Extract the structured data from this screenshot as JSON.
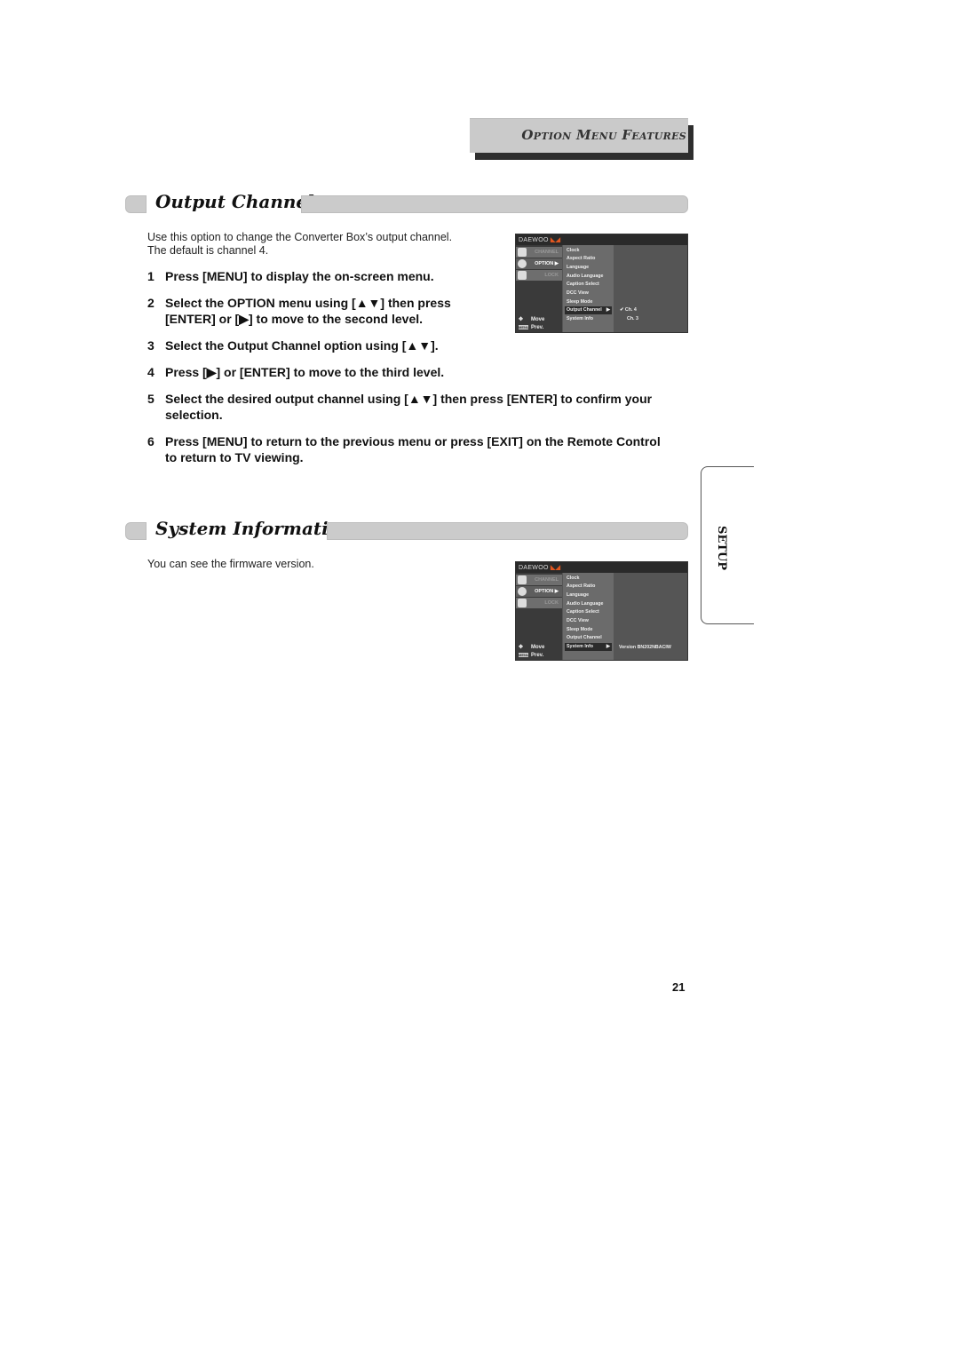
{
  "header": {
    "title": "Option Menu Features"
  },
  "sections": [
    {
      "title": "Output Channel",
      "intro": [
        "Use this option to change the Converter Box’s output channel.",
        "The default is channel 4."
      ],
      "steps": [
        {
          "num": "1",
          "lines": [
            "Press [MENU] to display the on-screen menu."
          ]
        },
        {
          "num": "2",
          "lines": [
            "Select the OPTION menu using [▲▼] then press",
            "[ENTER] or [▶] to move to the second level."
          ]
        },
        {
          "num": "3",
          "lines": [
            "Select the Output Channel option using [▲▼]."
          ]
        },
        {
          "num": "4",
          "lines": [
            "Press [▶] or [ENTER] to move to the third level."
          ]
        },
        {
          "num": "5",
          "lines": [
            "Select the desired output channel using [▲▼] then press [ENTER] to confirm your",
            "selection."
          ]
        },
        {
          "num": "6",
          "lines": [
            "Press [MENU] to return to the previous menu or press [EXIT] on the Remote Control",
            "to return to TV viewing."
          ]
        }
      ]
    },
    {
      "title": "System Information",
      "intro": [
        "You can see the firmware version."
      ]
    }
  ],
  "osd": {
    "brand": "DAEWOO",
    "left_menu": [
      "CHANNEL",
      "OPTION ▶",
      "LOCK"
    ],
    "options": [
      "Clock",
      "Aspect Ratio",
      "Language",
      "Audio Language",
      "Caption Select",
      "DCC View",
      "Sleep Mode",
      "Output Channel",
      "System Info"
    ],
    "help_move": "Move",
    "help_prev": "Prev.",
    "menu_key": "MENU",
    "screen1": {
      "selected": "Output Channel",
      "values": [
        "✔ Ch. 4",
        "Ch. 3"
      ]
    },
    "screen2": {
      "selected": "System Info",
      "values": [
        "Version BN202NBACIW"
      ]
    }
  },
  "side_tab": "SETUP",
  "page_number": "21"
}
